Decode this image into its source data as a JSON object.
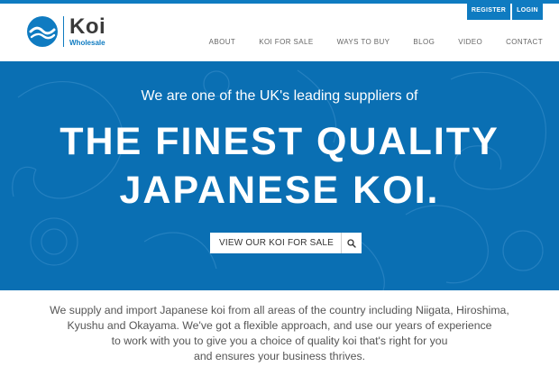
{
  "colors": {
    "brand_blue": "#0f7bc1",
    "hero_bg": "#0a6fb3",
    "text": "#555555"
  },
  "header": {
    "logo": {
      "name": "Koi",
      "subtitle": "Wholesale",
      "icon": "wave-circle-icon"
    },
    "auth": {
      "register": "REGISTER",
      "login": "LOGIN"
    },
    "nav": [
      "ABOUT",
      "KOI FOR SALE",
      "WAYS TO BUY",
      "BLOG",
      "VIDEO",
      "CONTACT"
    ]
  },
  "hero": {
    "subtitle": "We are one of the UK's leading suppliers of",
    "title_line1": "THE FINEST QUALITY",
    "title_line2": "JAPANESE KOI.",
    "cta_label": "VIEW OUR KOI FOR SALE",
    "cta_icon": "search-icon"
  },
  "intro": {
    "lines": [
      "We supply and import Japanese koi from all areas of the country including Niigata, Hiroshima,",
      "Kyushu and Okayama. We've got a flexible approach, and use our years of experience",
      "to work with you to give you a choice of quality koi that's right for you",
      "and ensures your business thrives."
    ]
  }
}
